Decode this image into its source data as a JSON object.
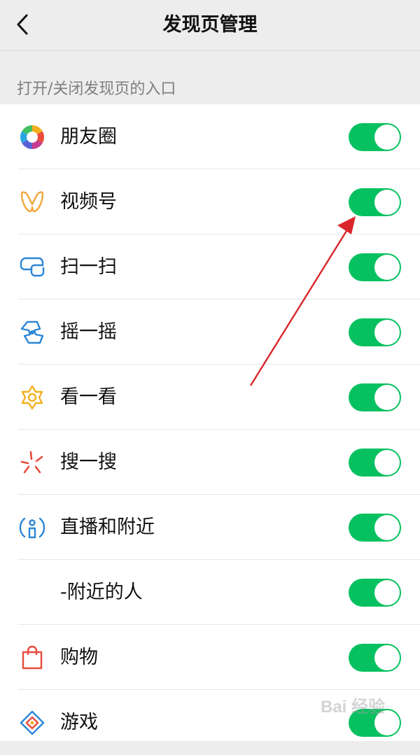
{
  "navbar": {
    "title": "发现页管理"
  },
  "section": {
    "header": "打开/关闭发现页的入口"
  },
  "items": [
    {
      "label": "朋友圈",
      "icon": "moments-icon",
      "enabled": true
    },
    {
      "label": "视频号",
      "icon": "channels-icon",
      "enabled": true
    },
    {
      "label": "扫一扫",
      "icon": "scan-icon",
      "enabled": true
    },
    {
      "label": "摇一摇",
      "icon": "shake-icon",
      "enabled": true
    },
    {
      "label": "看一看",
      "icon": "top-stories-icon",
      "enabled": true
    },
    {
      "label": "搜一搜",
      "icon": "search-icon",
      "enabled": true
    },
    {
      "label": "直播和附近",
      "icon": "live-nearby-icon",
      "enabled": true
    },
    {
      "label": "-附近的人",
      "icon": "",
      "enabled": true
    },
    {
      "label": "购物",
      "icon": "shopping-bag-icon",
      "enabled": true
    },
    {
      "label": "游戏",
      "icon": "games-icon",
      "enabled": true
    }
  ],
  "annotation": {
    "type": "red-arrow",
    "target": "视频号 toggle",
    "color": "#d9262b"
  },
  "watermark": {
    "text": "Bai 经验"
  },
  "colors": {
    "toggle_on": "#07c160",
    "background": "#ededed"
  }
}
